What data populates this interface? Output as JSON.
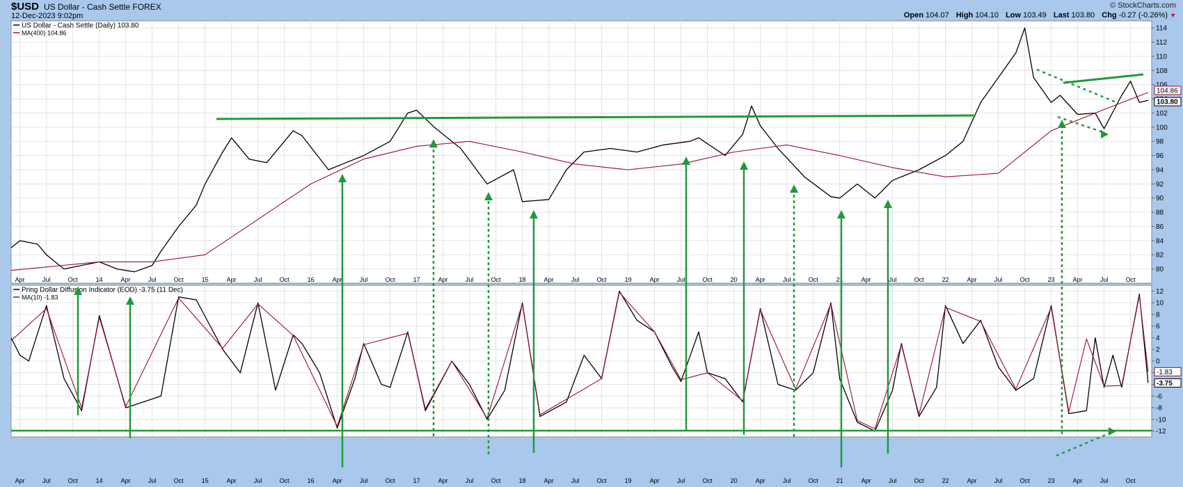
{
  "header": {
    "symbol": "$USD",
    "name": "US Dollar - Cash Settle FOREX",
    "date": "12-Dec-2023 9:02pm",
    "copyright": "© StockCharts.com",
    "ohlc": [
      {
        "label": "Open",
        "value": "104.07"
      },
      {
        "label": "High",
        "value": "104.10"
      },
      {
        "label": "Low",
        "value": "103.49"
      },
      {
        "label": "Last",
        "value": "103.80"
      },
      {
        "label": "Chg",
        "value": "-0.27 (-0.26%)"
      }
    ]
  },
  "chart_data": [
    {
      "type": "line",
      "legend": [
        "US Dollar - Cash Settle (Daily) 103.80",
        "MA(400) 104.86"
      ],
      "ylim": [
        78,
        115
      ],
      "yticks": [
        80,
        82,
        84,
        86,
        88,
        90,
        92,
        94,
        96,
        98,
        100,
        102,
        104,
        106,
        108,
        110,
        112,
        114
      ],
      "grid": true,
      "value_tags": [
        "104.86",
        "103.80"
      ],
      "x_tick_labels": [
        "Apr",
        "Jul",
        "Oct",
        "14",
        "Apr",
        "Jul",
        "Oct",
        "15",
        "Apr",
        "Jul",
        "Oct",
        "16",
        "Apr",
        "Jul",
        "Oct",
        "17",
        "Apr",
        "Jul",
        "Oct",
        "18",
        "Apr",
        "Jul",
        "Oct",
        "19",
        "Apr",
        "Jul",
        "Oct",
        "20",
        "Apr",
        "Jul",
        "Oct",
        "21",
        "Apr",
        "Jul",
        "Oct",
        "22",
        "Apr",
        "Jul",
        "Oct",
        "23",
        "Apr",
        "Jul",
        "Oct"
      ],
      "series": [
        {
          "name": "US Dollar - Cash Settle (Daily)",
          "color": "#000000",
          "x": [
            "2013-03",
            "2013-04",
            "2013-06",
            "2013-07",
            "2013-09",
            "2013-11",
            "2014-01",
            "2014-03",
            "2014-05",
            "2014-07",
            "2014-08",
            "2014-10",
            "2014-12",
            "2015-01",
            "2015-03",
            "2015-04",
            "2015-06",
            "2015-08",
            "2015-11",
            "2015-12",
            "2016-03",
            "2016-05",
            "2016-07",
            "2016-10",
            "2016-12",
            "2017-01",
            "2017-03",
            "2017-06",
            "2017-09",
            "2017-12",
            "2018-01",
            "2018-04",
            "2018-06",
            "2018-08",
            "2018-11",
            "2019-02",
            "2019-05",
            "2019-08",
            "2019-09",
            "2019-12",
            "2020-02",
            "2020-03",
            "2020-04",
            "2020-06",
            "2020-09",
            "2020-12",
            "2021-01",
            "2021-03",
            "2021-05",
            "2021-07",
            "2021-10",
            "2022-01",
            "2022-03",
            "2022-05",
            "2022-07",
            "2022-09",
            "2022-10",
            "2022-11",
            "2023-01",
            "2023-02",
            "2023-04",
            "2023-06",
            "2023-07",
            "2023-09",
            "2023-10",
            "2023-11",
            "2023-12"
          ],
          "values": [
            83,
            84,
            83.5,
            82,
            80,
            80.5,
            81,
            80,
            79.6,
            80.5,
            82.5,
            86,
            89,
            92,
            96.5,
            98.5,
            95.5,
            95,
            99.5,
            98.8,
            94,
            95,
            96,
            98,
            102,
            102.4,
            100,
            97,
            92,
            94,
            89.5,
            89.8,
            94,
            96.5,
            97,
            96.5,
            97.5,
            98,
            98.5,
            96,
            99,
            103,
            100.2,
            97,
            93,
            90.2,
            90,
            92,
            90,
            92.5,
            94,
            96,
            98,
            103.5,
            107,
            110.5,
            114,
            107,
            103.5,
            104.5,
            101.8,
            102,
            99.8,
            104.5,
            106.5,
            103.5,
            103.8
          ]
        },
        {
          "name": "MA(400)",
          "color": "#9a0f2a",
          "x": [
            "2013-03",
            "2014-01",
            "2014-07",
            "2015-01",
            "2015-07",
            "2016-01",
            "2016-07",
            "2017-01",
            "2017-07",
            "2018-01",
            "2018-07",
            "2019-01",
            "2019-07",
            "2020-01",
            "2020-07",
            "2021-01",
            "2021-07",
            "2022-01",
            "2022-07",
            "2023-01",
            "2023-07",
            "2023-12"
          ],
          "values": [
            79.8,
            81,
            81,
            82,
            87,
            92,
            95.5,
            97.3,
            98,
            96.5,
            94.8,
            94,
            94.8,
            96.5,
            97.5,
            96,
            94.3,
            93,
            93.5,
            99.5,
            102.5,
            104.9
          ]
        }
      ]
    },
    {
      "type": "line",
      "legend": [
        "Pring Dollar Diffusion Indicator (EOD) -3.75 (11 Dec)",
        "MA(10) -1.83"
      ],
      "ylim": [
        -13,
        13
      ],
      "yticks": [
        -12,
        -10,
        -8,
        -6,
        -4,
        -2,
        0,
        2,
        4,
        6,
        8,
        10,
        12
      ],
      "grid": true,
      "value_tags": [
        "-1.83",
        "-3.75"
      ],
      "x_tick_labels": [
        "Apr",
        "Jul",
        "Oct",
        "14",
        "Apr",
        "Jul",
        "Oct",
        "15",
        "Apr",
        "Jul",
        "Oct",
        "16",
        "Apr",
        "Jul",
        "Oct",
        "17",
        "Apr",
        "Jul",
        "Oct",
        "18",
        "Apr",
        "Jul",
        "Oct",
        "19",
        "Apr",
        "Jul",
        "Oct",
        "20",
        "Apr",
        "Jul",
        "Oct",
        "21",
        "Apr",
        "Jul",
        "Oct",
        "22",
        "Apr",
        "Jul",
        "Oct",
        "23",
        "Apr",
        "Jul",
        "Oct"
      ],
      "series": [
        {
          "name": "Pring Dollar Diffusion Indicator (EOD)",
          "color": "#000000",
          "x": [
            "2013-03",
            "2013-04",
            "2013-05",
            "2013-07",
            "2013-09",
            "2013-11",
            "2014-01",
            "2014-04",
            "2014-06",
            "2014-08",
            "2014-10",
            "2014-12",
            "2015-03",
            "2015-05",
            "2015-07",
            "2015-09",
            "2015-11",
            "2015-12",
            "2016-02",
            "2016-04",
            "2016-06",
            "2016-07",
            "2016-09",
            "2016-10",
            "2016-12",
            "2017-02",
            "2017-05",
            "2017-07",
            "2017-09",
            "2017-11",
            "2018-01",
            "2018-03",
            "2018-06",
            "2018-08",
            "2018-10",
            "2018-12",
            "2019-02",
            "2019-04",
            "2019-06",
            "2019-07",
            "2019-09",
            "2019-10",
            "2019-12",
            "2020-02",
            "2020-04",
            "2020-06",
            "2020-08",
            "2020-10",
            "2020-12",
            "2021-01",
            "2021-03",
            "2021-05",
            "2021-07",
            "2021-08",
            "2021-10",
            "2021-12",
            "2022-01",
            "2022-03",
            "2022-05",
            "2022-07",
            "2022-09",
            "2022-11",
            "2023-01",
            "2023-03",
            "2023-05",
            "2023-06",
            "2023-07",
            "2023-08",
            "2023-09",
            "2023-11",
            "2023-12"
          ],
          "values": [
            4,
            1,
            0,
            9.5,
            -3,
            -8.5,
            7.8,
            -8,
            -7,
            -6,
            11,
            10.5,
            2,
            -2,
            10,
            -5,
            4.5,
            3,
            -2,
            -11.5,
            -3,
            3,
            -4,
            -4.5,
            5,
            -8.5,
            0,
            -4,
            -10,
            -5,
            10,
            -9.5,
            -7,
            1,
            -3,
            12,
            7,
            5,
            -1,
            -3.5,
            5,
            -2,
            -3,
            -7,
            9,
            -4,
            -5,
            -2,
            10,
            -3,
            -10.5,
            -12,
            -5,
            3,
            -9.5,
            -4.5,
            9.5,
            3,
            7,
            -1,
            -5,
            -3,
            9.5,
            -9,
            -8.5,
            4,
            -4.5,
            1,
            -4.5,
            11.5,
            -3.75
          ]
        },
        {
          "name": "MA(10)",
          "color": "#9a0f2a",
          "x": [
            "2013-03",
            "2013-07",
            "2013-11",
            "2014-01",
            "2014-04",
            "2014-10",
            "2015-03",
            "2015-07",
            "2015-11",
            "2016-04",
            "2016-07",
            "2016-12",
            "2017-02",
            "2017-05",
            "2017-09",
            "2018-01",
            "2018-03",
            "2018-10",
            "2018-12",
            "2019-04",
            "2019-07",
            "2019-10",
            "2020-02",
            "2020-04",
            "2020-08",
            "2020-12",
            "2021-03",
            "2021-05",
            "2021-08",
            "2021-10",
            "2022-01",
            "2022-05",
            "2022-09",
            "2023-01",
            "2023-03",
            "2023-05",
            "2023-07",
            "2023-09",
            "2023-11",
            "2023-12"
          ],
          "values": [
            3.5,
            9,
            -8,
            7.5,
            -7.8,
            10.8,
            2.2,
            9.8,
            4.4,
            -11.2,
            2.8,
            4.8,
            -8.2,
            0,
            -9.8,
            9.8,
            -9.2,
            -3,
            11.8,
            5,
            -3.2,
            -2,
            -6.8,
            8.8,
            -4.8,
            9.8,
            -10.2,
            -11.6,
            2.8,
            -9.2,
            9.2,
            6.8,
            -4.8,
            9.2,
            -8.7,
            3.8,
            -4.3,
            -4.2,
            11.2,
            -1.83
          ]
        }
      ]
    }
  ]
}
